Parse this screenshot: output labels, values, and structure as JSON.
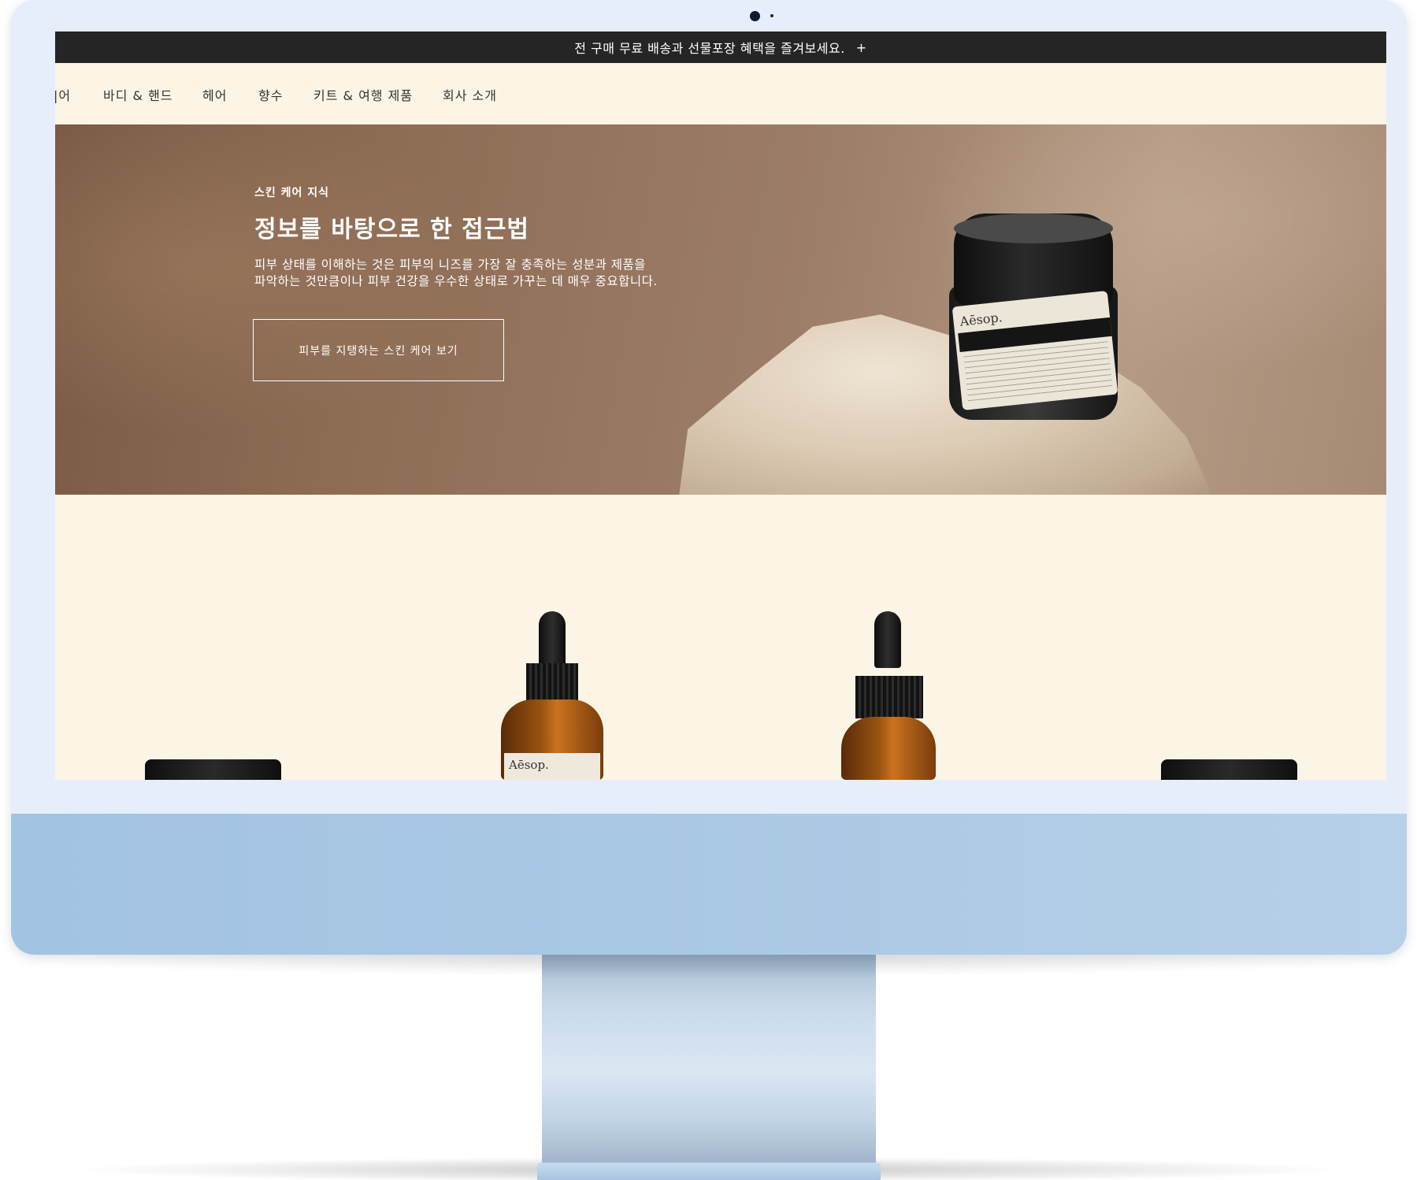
{
  "promo": {
    "text": "전 구매 무료 배송과 선물포장 혜택을 즐겨보세요.",
    "expand_label": "+"
  },
  "nav": {
    "items": [
      {
        "label": "|어"
      },
      {
        "label": "바디 & 핸드"
      },
      {
        "label": "헤어"
      },
      {
        "label": "향수"
      },
      {
        "label": "키트 & 여행 제품"
      },
      {
        "label": "회사 소개"
      }
    ]
  },
  "hero": {
    "eyebrow": "스킨 케어 지식",
    "title": "정보를 바탕으로 한 접근법",
    "body_line1": "피부 상태를 이해하는 것은 피부의 니즈를 가장 잘 충족하는 성분과 제품을",
    "body_line2": "파악하는 것만큼이나 피부 건강을 우수한 상태로 가꾸는 데 매우 중요합니다.",
    "cta_label": "피부를 지탱하는 스킨 케어 보기",
    "product_brand": "Aēsop."
  },
  "products": {
    "bottle_brand": "Aēsop."
  },
  "colors": {
    "promo_bg": "#252525",
    "page_bg": "#fcf5e6",
    "bezel": "#e6eefb",
    "chin": "#a9c8e4"
  }
}
